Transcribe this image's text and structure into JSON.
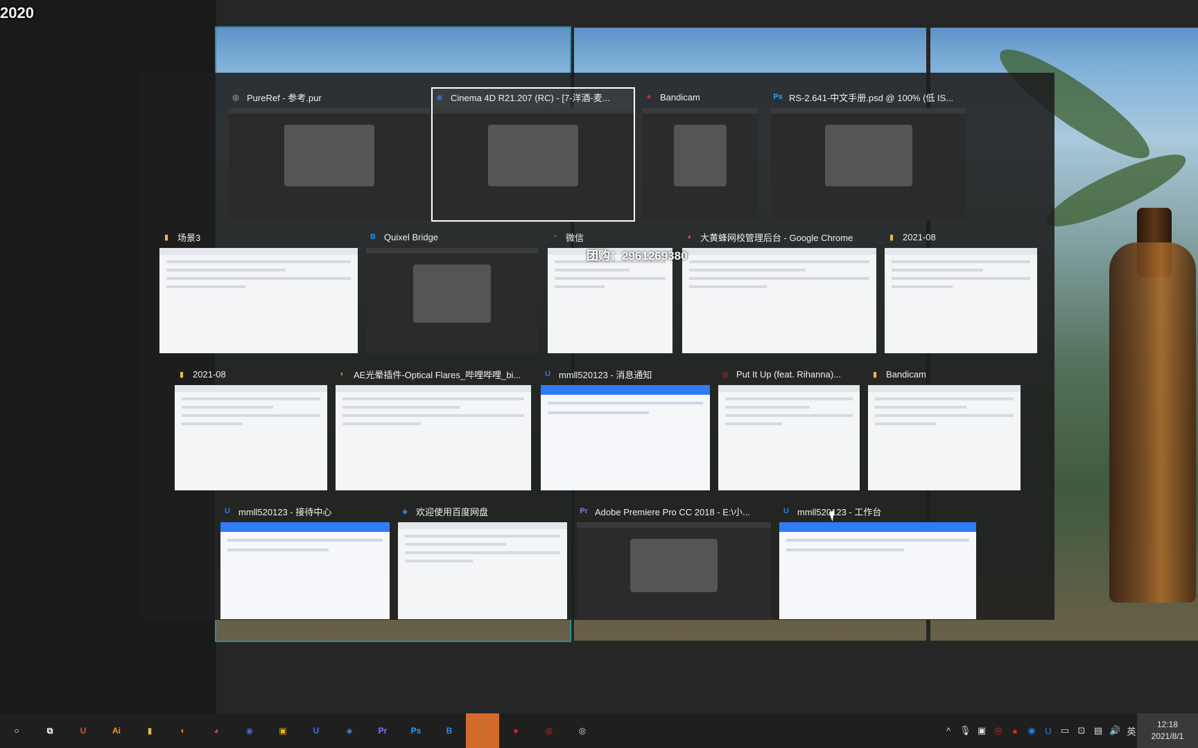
{
  "top_label": "2020",
  "watermark": "团购：2961269380",
  "windows": [
    {
      "title": "PureRef - 参考.pur",
      "icon": "pureref-icon",
      "icon_glyph": "◎",
      "icon_color": "#cfcfcf",
      "thumb": "dark"
    },
    {
      "title": "Cinema 4D R21.207 (RC) - [7-洋酒-麦...",
      "icon": "cinema4d-icon",
      "icon_glyph": "◉",
      "icon_color": "#4a66c9",
      "thumb": "dark",
      "selected": true
    },
    {
      "title": "Bandicam",
      "icon": "bandicam-icon",
      "icon_glyph": "●",
      "icon_color": "#e0242a",
      "thumb": "dark"
    },
    {
      "title": "RS-2.641-中文手册.psd @ 100% (低 IS...",
      "icon": "photoshop-icon",
      "icon_glyph": "Ps",
      "icon_color": "#2fa3f7",
      "thumb": "dark"
    },
    {
      "title": "场景3",
      "icon": "folder-icon",
      "icon_glyph": "▮",
      "icon_color": "#e9b949",
      "thumb": "light"
    },
    {
      "title": "Quixel Bridge",
      "icon": "quixel-bridge-icon",
      "icon_glyph": "B",
      "icon_color": "#2d8ce8",
      "thumb": "dark"
    },
    {
      "title": "微信",
      "icon": "wechat-icon",
      "icon_glyph": "◔",
      "icon_color": "#3bb54a",
      "thumb": "light"
    },
    {
      "title": "大黄蜂网校管理后台 - Google Chrome",
      "icon": "chrome-icon",
      "icon_glyph": "◕",
      "icon_color": "#e94335",
      "thumb": "light"
    },
    {
      "title": "2021-08",
      "icon": "folder-icon",
      "icon_glyph": "▮",
      "icon_color": "#e9b949",
      "thumb": "light"
    },
    {
      "title": "2021-08",
      "icon": "folder-icon",
      "icon_glyph": "▮",
      "icon_color": "#e9b949",
      "thumb": "light"
    },
    {
      "title": "AE光晕插件-Optical Flares_哔哩哔哩_bi...",
      "icon": "firefox-icon",
      "icon_glyph": "◐",
      "icon_color": "#f27a1a",
      "thumb": "light"
    },
    {
      "title": "mmll520123 - 消息通知",
      "icon": "qianniu-icon",
      "icon_glyph": "U",
      "icon_color": "#2b7de9",
      "thumb": "blue"
    },
    {
      "title": "Put It Up (feat. Rihanna)...",
      "icon": "netease-music-icon",
      "icon_glyph": "◎",
      "icon_color": "#e0242a",
      "thumb": "light"
    },
    {
      "title": "Bandicam",
      "icon": "folder-icon",
      "icon_glyph": "▮",
      "icon_color": "#e9b949",
      "thumb": "light"
    },
    {
      "title": "mmll520123 - 接待中心",
      "icon": "qianniu-icon",
      "icon_glyph": "U",
      "icon_color": "#2b7de9",
      "thumb": "blue"
    },
    {
      "title": "欢迎使用百度网盘",
      "icon": "baidu-netdisk-icon",
      "icon_glyph": "◈",
      "icon_color": "#3a8bf0",
      "thumb": "light"
    },
    {
      "title": "Adobe Premiere Pro CC 2018 - E:\\小...",
      "icon": "premiere-icon",
      "icon_glyph": "Pr",
      "icon_color": "#9a6cf5",
      "thumb": "dark"
    },
    {
      "title": "mmll520123 - 工作台",
      "icon": "qianniu-icon",
      "icon_glyph": "U",
      "icon_color": "#2b7de9",
      "thumb": "blue"
    }
  ],
  "taskbar": {
    "items": [
      {
        "name": "search-icon",
        "glyph": "○",
        "color": "#ffffff"
      },
      {
        "name": "task-view-icon",
        "glyph": "⧉",
        "color": "#ffffff"
      },
      {
        "name": "app-u-icon",
        "glyph": "U",
        "color": "#e8551f"
      },
      {
        "name": "illustrator-icon",
        "glyph": "Ai",
        "color": "#f39a1b"
      },
      {
        "name": "file-explorer-icon",
        "glyph": "▮",
        "color": "#e9b949"
      },
      {
        "name": "firefox-icon",
        "glyph": "◐",
        "color": "#f27a1a"
      },
      {
        "name": "chrome-icon",
        "glyph": "◕",
        "color": "#e94335"
      },
      {
        "name": "cinema4d-icon",
        "glyph": "◉",
        "color": "#4a66c9"
      },
      {
        "name": "app-orange-icon",
        "glyph": "▣",
        "color": "#f0b400"
      },
      {
        "name": "qianniu-icon",
        "glyph": "U",
        "color": "#2b7de9"
      },
      {
        "name": "baidu-netdisk-icon",
        "glyph": "◈",
        "color": "#3a8bf0"
      },
      {
        "name": "premiere-icon",
        "glyph": "Pr",
        "color": "#9a6cf5"
      },
      {
        "name": "photoshop-icon",
        "glyph": "Ps",
        "color": "#2fa3f7"
      },
      {
        "name": "quixel-bridge-icon",
        "glyph": "B",
        "color": "#2d8ce8"
      },
      {
        "name": "wechat-icon",
        "glyph": "◔",
        "color": "#3bb54a"
      },
      {
        "name": "bandicam-icon",
        "glyph": "●",
        "color": "#e0242a"
      },
      {
        "name": "netease-music-icon",
        "glyph": "◎",
        "color": "#e0242a"
      },
      {
        "name": "pureref-icon",
        "glyph": "◎",
        "color": "#dddddd"
      }
    ],
    "ime": "英",
    "time": "12:18",
    "date": "2021/8/1"
  }
}
